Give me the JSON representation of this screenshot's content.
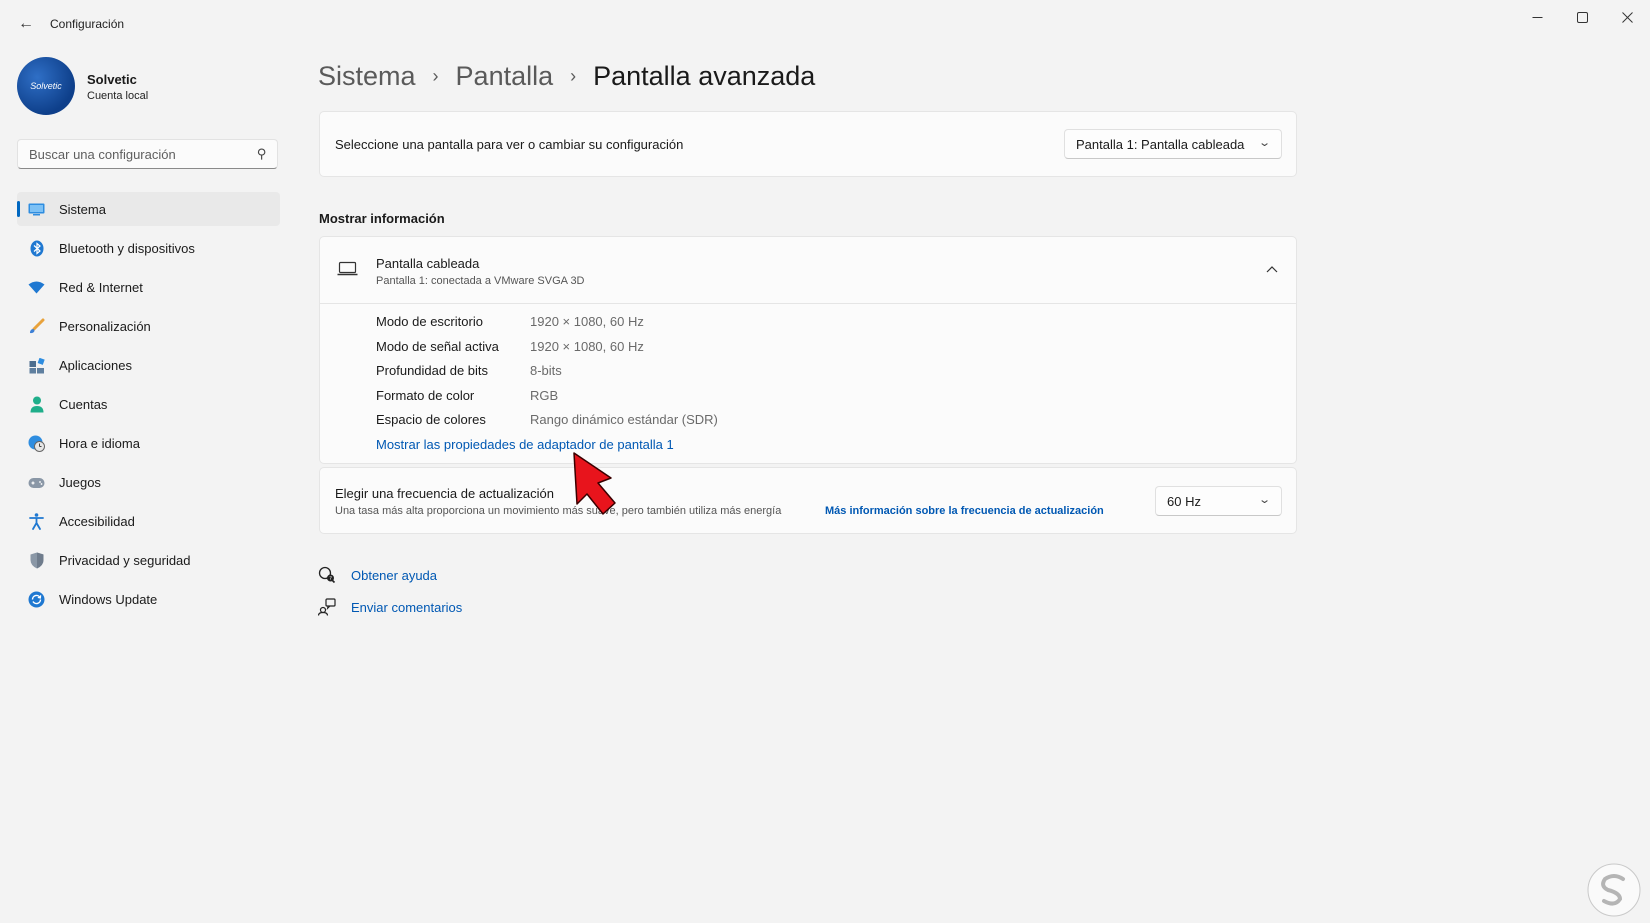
{
  "window": {
    "title": "Configuración"
  },
  "profile": {
    "avatar_text": "Solvetic",
    "name": "Solvetic",
    "account_type": "Cuenta local"
  },
  "search": {
    "placeholder": "Buscar una configuración"
  },
  "sidebar": {
    "items": [
      {
        "label": "Sistema",
        "icon": "system-icon",
        "active": true
      },
      {
        "label": "Bluetooth y dispositivos",
        "icon": "bluetooth-icon"
      },
      {
        "label": "Red & Internet",
        "icon": "wifi-icon"
      },
      {
        "label": "Personalización",
        "icon": "brush-icon"
      },
      {
        "label": "Aplicaciones",
        "icon": "apps-icon"
      },
      {
        "label": "Cuentas",
        "icon": "account-icon"
      },
      {
        "label": "Hora e idioma",
        "icon": "clock-globe-icon"
      },
      {
        "label": "Juegos",
        "icon": "gamepad-icon"
      },
      {
        "label": "Accesibilidad",
        "icon": "accessibility-icon"
      },
      {
        "label": "Privacidad y seguridad",
        "icon": "shield-icon"
      },
      {
        "label": "Windows Update",
        "icon": "update-icon"
      }
    ]
  },
  "breadcrumb": {
    "level1": "Sistema",
    "level2": "Pantalla",
    "level3": "Pantalla avanzada",
    "separator": "›"
  },
  "display_select": {
    "label": "Seleccione una pantalla para ver o cambiar su configuración",
    "selected": "Pantalla 1: Pantalla cableada"
  },
  "display_info": {
    "section_title": "Mostrar información",
    "title": "Pantalla cableada",
    "subtitle": "Pantalla 1: conectada a VMware SVGA 3D",
    "rows": [
      {
        "label": "Modo de escritorio",
        "value": "1920 × 1080, 60 Hz"
      },
      {
        "label": "Modo de señal activa",
        "value": "1920 × 1080, 60 Hz"
      },
      {
        "label": "Profundidad de bits",
        "value": "8-bits"
      },
      {
        "label": "Formato de color",
        "value": "RGB"
      },
      {
        "label": "Espacio de colores",
        "value": "Rango dinámico estándar (SDR)"
      }
    ],
    "adapter_link": "Mostrar las propiedades de adaptador de pantalla 1"
  },
  "refresh_rate": {
    "title": "Elegir una frecuencia de actualización",
    "description": "Una tasa más alta proporciona un movimiento más suave, pero también utiliza más energía",
    "link": "Más información sobre la frecuencia de actualización",
    "selected": "60 Hz"
  },
  "help_links": {
    "get_help": "Obtener ayuda",
    "feedback": "Enviar comentarios"
  },
  "colors": {
    "accent": "#0067c0",
    "link": "#0058b3",
    "background": "#f3f3f3",
    "card": "#fbfbfb",
    "annotation_arrow": "#e8141c"
  }
}
